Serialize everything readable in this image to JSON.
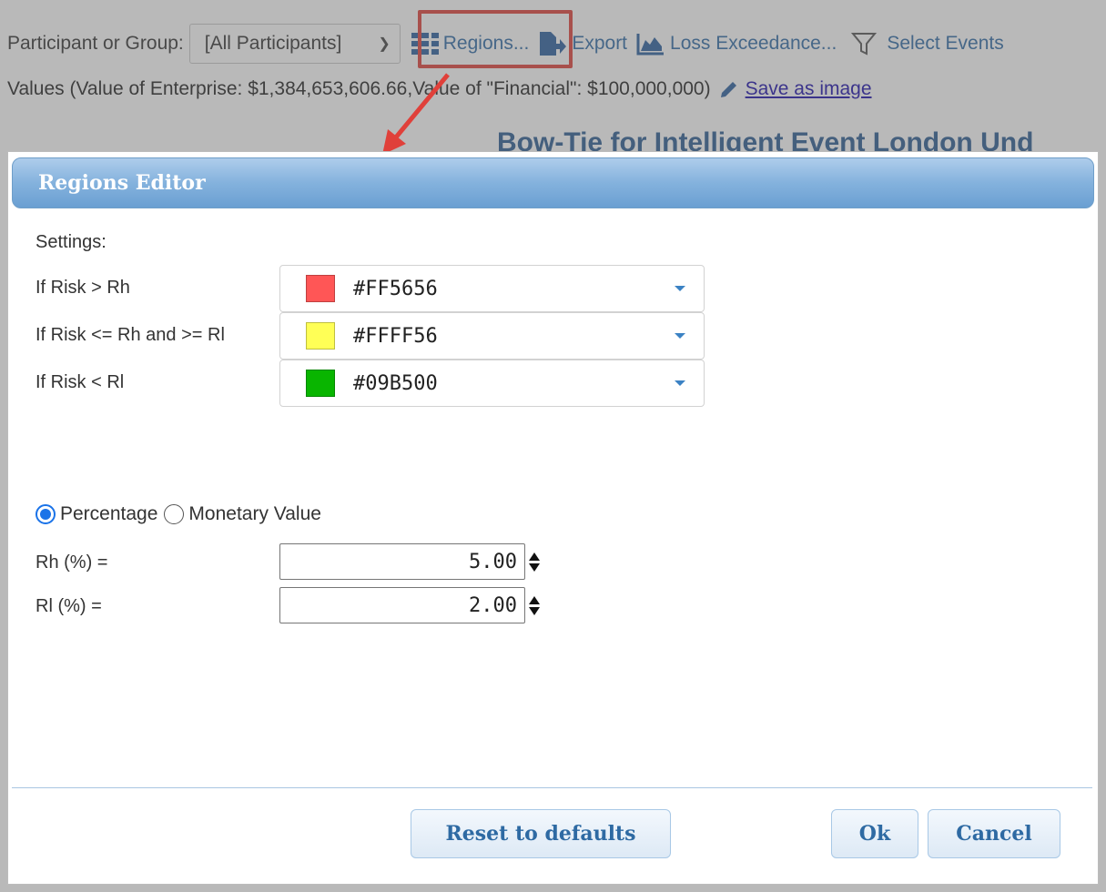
{
  "toolbar": {
    "participant_label": "Participant or Group:",
    "participant_value": "[All Participants]",
    "regions_label": "Regions...",
    "export_label": "Export",
    "loss_label": "Loss Exceedance...",
    "select_events_label": "Select Events"
  },
  "values_line": {
    "text": "Values (Value of Enterprise: $1,384,653,606.66,Value of \"Financial\": $100,000,000)",
    "save_link": "Save as image"
  },
  "background_title": "Bow-Tie for Intelligent Event London Und",
  "dialog": {
    "title": "Regions Editor",
    "settings_label": "Settings:",
    "rules": [
      {
        "label": "If Risk > Rh",
        "color": "#FF5656"
      },
      {
        "label": "If Risk <= Rh and >= Rl",
        "color": "#FFFF56"
      },
      {
        "label": "If Risk < Rl",
        "color": "#09B500"
      }
    ],
    "mode": {
      "percentage_label": "Percentage",
      "monetary_label": "Monetary Value",
      "selected": "percentage"
    },
    "rh": {
      "label": "Rh (%) =",
      "value": "5.00"
    },
    "rl": {
      "label": "Rl (%) =",
      "value": "2.00"
    },
    "buttons": {
      "reset": "Reset to defaults",
      "ok": "Ok",
      "cancel": "Cancel"
    }
  },
  "colors": {
    "accent": "#2f6aa6",
    "highlight_box": "#e0403a",
    "header_blue": "#84b2dd"
  }
}
